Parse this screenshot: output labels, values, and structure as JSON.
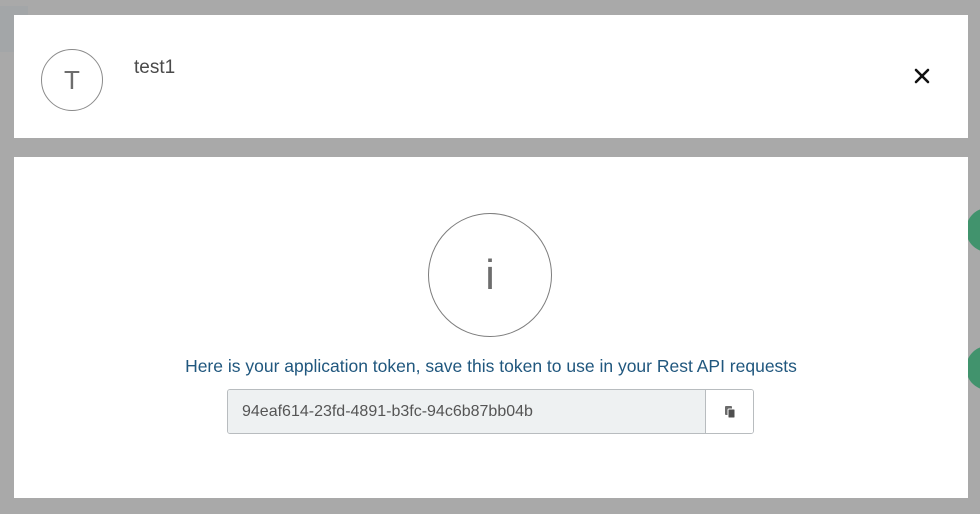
{
  "header": {
    "avatar_initial": "T",
    "username": "test1"
  },
  "dialog": {
    "info_symbol": "i",
    "message": "Here is your application token, save this token to use in your Rest API requests",
    "token_value": "94eaf614-23fd-4891-b3fc-94c6b87bb04b"
  },
  "icons": {
    "close": "close-icon",
    "copy": "copy-icon"
  },
  "colors": {
    "message_text": "#20577e",
    "input_background": "#eef1f2",
    "overlay": "#a9a9a9",
    "backdrop_accent": "#2f8f63"
  }
}
